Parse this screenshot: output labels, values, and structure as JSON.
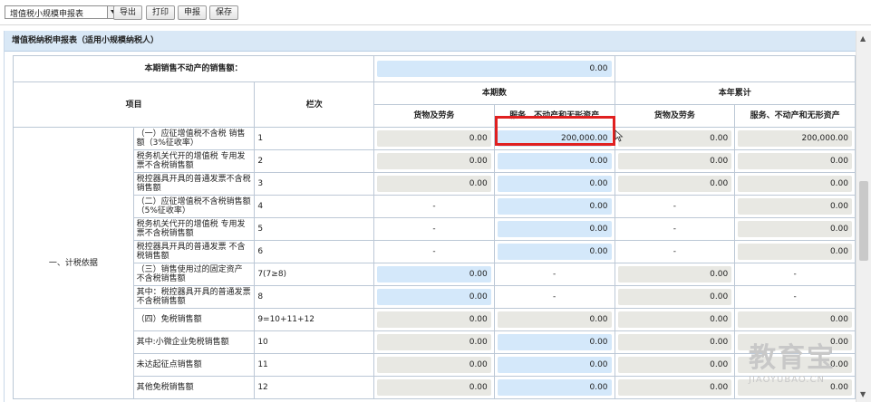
{
  "toolbar": {
    "report_select": "增值税小规模申报表",
    "buttons": [
      "导出",
      "打印",
      "申报",
      "保存"
    ]
  },
  "form": {
    "title": "增值税纳税申报表（适用小规模纳税人）",
    "real_estate_label": "本期销售不动产的销售额：",
    "real_estate_value": "0.00",
    "headers": {
      "item": "项目",
      "line": "栏次",
      "current_period": "本期数",
      "ytd": "本年累计",
      "goods": "货物及劳务",
      "services": "服务、不动产和无形资产"
    },
    "category": "一、计税依据",
    "rows": [
      {
        "label": "（一）应征增值税不含税 销售额（3%征收率）",
        "line": "1",
        "cp_goods": "0.00",
        "cp_services": "200,000.00",
        "ytd_goods": "0.00",
        "ytd_services": "200,000.00"
      },
      {
        "label": "税务机关代开的增值税 专用发票不含税销售额",
        "line": "2",
        "cp_goods": "0.00",
        "cp_services": "0.00",
        "ytd_goods": "0.00",
        "ytd_services": "0.00"
      },
      {
        "label": "税控器具开具的普通发票不含税销售额",
        "line": "3",
        "cp_goods": "0.00",
        "cp_services": "0.00",
        "ytd_goods": "0.00",
        "ytd_services": "0.00"
      },
      {
        "label": "（二）应征增值税不含税销售额（5%征收率）",
        "line": "4",
        "cp_goods": "-",
        "cp_services": "0.00",
        "ytd_goods": "-",
        "ytd_services": "0.00"
      },
      {
        "label": "税务机关代开的增值税 专用发票不含税销售额",
        "line": "5",
        "cp_goods": "-",
        "cp_services": "0.00",
        "ytd_goods": "-",
        "ytd_services": "0.00"
      },
      {
        "label": "税控器具开具的普通发票 不含税销售额",
        "line": "6",
        "cp_goods": "-",
        "cp_services": "0.00",
        "ytd_goods": "-",
        "ytd_services": "0.00"
      },
      {
        "label": "（三）销售使用过的固定资产 不含税销售额",
        "line": "7(7≥8)",
        "cp_goods": "0.00",
        "cp_services": "-",
        "ytd_goods": "0.00",
        "ytd_services": "-"
      },
      {
        "label": "其中：税控器具开具的普通发票不含税销售额",
        "line": "8",
        "cp_goods": "0.00",
        "cp_services": "-",
        "ytd_goods": "0.00",
        "ytd_services": "-"
      },
      {
        "label": "（四）免税销售额",
        "line": "9=10+11+12",
        "cp_goods": "0.00",
        "cp_services": "0.00",
        "ytd_goods": "0.00",
        "ytd_services": "0.00"
      },
      {
        "label": "其中:小微企业免税销售额",
        "line": "10",
        "cp_goods": "0.00",
        "cp_services": "0.00",
        "ytd_goods": "0.00",
        "ytd_services": "0.00"
      },
      {
        "label": "未达起征点销售额",
        "line": "11",
        "cp_goods": "0.00",
        "cp_services": "0.00",
        "ytd_goods": "0.00",
        "ytd_services": "0.00"
      },
      {
        "label": "其他免税销售额",
        "line": "12",
        "cp_goods": "0.00",
        "cp_services": "0.00",
        "ytd_goods": "0.00",
        "ytd_services": "0.00"
      }
    ]
  },
  "watermark": {
    "cn": "教育宝",
    "en": "JIAOYUBAO.CN"
  },
  "colors": {
    "highlight": "#e02020",
    "editable_cell": "#d4e8fa",
    "readonly_cell": "#e8e8e3",
    "title_bar": "#d9e8f6"
  }
}
